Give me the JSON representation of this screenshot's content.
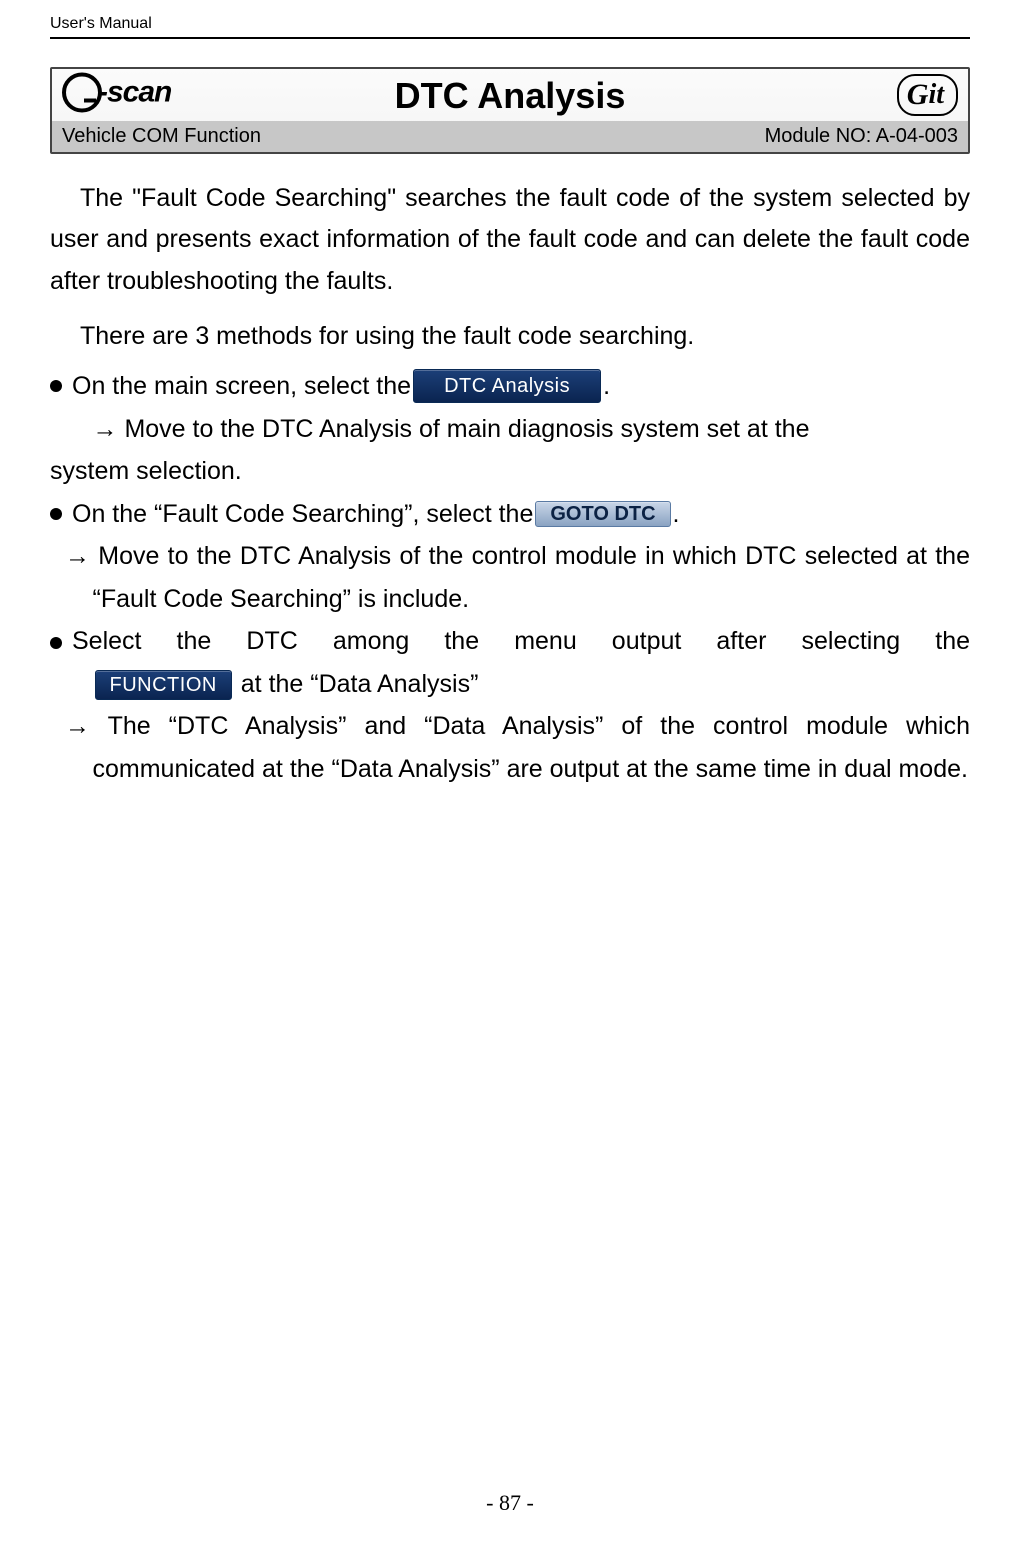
{
  "header": {
    "manual_title": "User's Manual"
  },
  "section": {
    "title": "DTC Analysis",
    "left_label": "Vehicle COM Function",
    "right_label": "Module NO: A-04-003",
    "logo_left_text": "-scan",
    "logo_right_text": "it",
    "logo_right_g": "G"
  },
  "body": {
    "p1": "The \"Fault Code Searching\" searches the fault code of the system selected by user and presents exact information of the fault code and can delete the fault code after troubleshooting the faults.",
    "p2": "There are 3 methods for using the fault code searching.",
    "b1_pre": "On the main screen, select the ",
    "b1_btn": "DTC Analysis",
    "b1_post": ".",
    "b1_arrow": "→ Move to the DTC Analysis of main diagnosis system set at the",
    "b1_arrow_cont": "system selection.",
    "b2_pre": "On the “Fault Code Searching”, select the ",
    "b2_btn": "GOTO DTC",
    "b2_post": ".",
    "b2_arrow": "→ Move to the DTC Analysis of the control module in which DTC selected at the “Fault Code Searching” is include.",
    "b3_pre": "Select the DTC among the menu output after selecting the",
    "b3_btn": "FUNCTION",
    "b3_post": " at the “Data Analysis”",
    "b3_arrow": "→ The “DTC Analysis” and “Data Analysis” of the control module which communicated at the “Data Analysis” are output at the same time in dual mode."
  },
  "footer": {
    "page_no": "- 87 -"
  }
}
